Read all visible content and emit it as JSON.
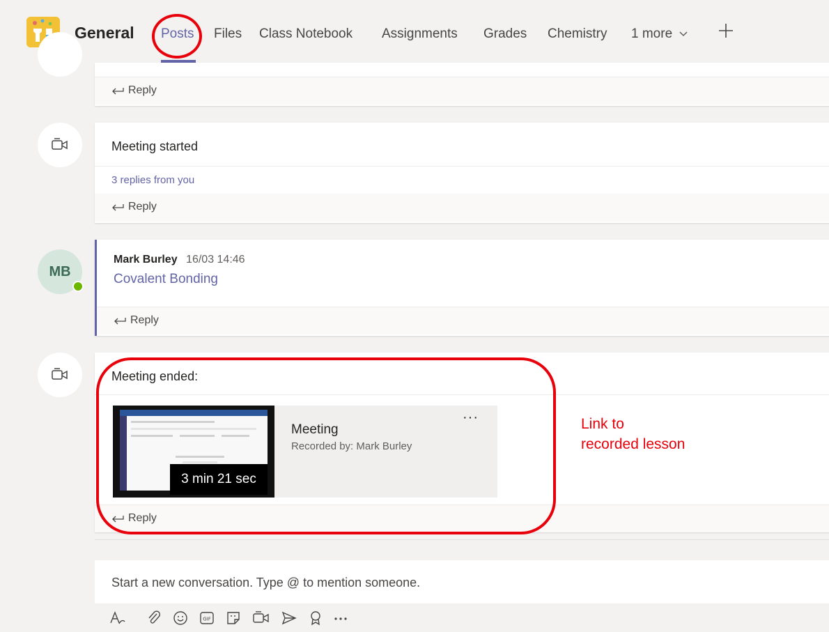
{
  "header": {
    "team_name": "General",
    "tabs": [
      {
        "label": "Posts"
      },
      {
        "label": "Files"
      },
      {
        "label": "Class Notebook"
      },
      {
        "label": "Assignments"
      },
      {
        "label": "Grades"
      },
      {
        "label": "Chemistry"
      },
      {
        "label": "1 more"
      }
    ],
    "active_tab": "Posts"
  },
  "posts": [
    {
      "reply_label": "Reply"
    },
    {
      "title": "Meeting started",
      "replies": "3 replies from you",
      "reply_label": "Reply"
    },
    {
      "avatar_initials": "MB",
      "author": "Mark Burley",
      "time": "16/03 14:46",
      "link_text": "Covalent Bonding",
      "reply_label": "Reply"
    },
    {
      "title": "Meeting ended:",
      "reply_label": "Reply",
      "recording": {
        "title": "Meeting",
        "recorded_by": "Recorded by: Mark Burley",
        "duration": "3 min 21 sec",
        "more": "···"
      }
    }
  ],
  "annotation": {
    "text": "Link to recorded lesson",
    "color": "#e8000b"
  },
  "composer": {
    "placeholder": "Start a new conversation. Type @ to mention someone."
  },
  "toolbar_icons": [
    "format-icon",
    "attach-icon",
    "emoji-icon",
    "gif-icon",
    "sticker-icon",
    "meet-now-icon",
    "send-icon",
    "praise-icon",
    "more-options-icon"
  ],
  "colors": {
    "accent": "#6264a7",
    "presence": "#6bb700",
    "annotation": "#e8000b"
  }
}
